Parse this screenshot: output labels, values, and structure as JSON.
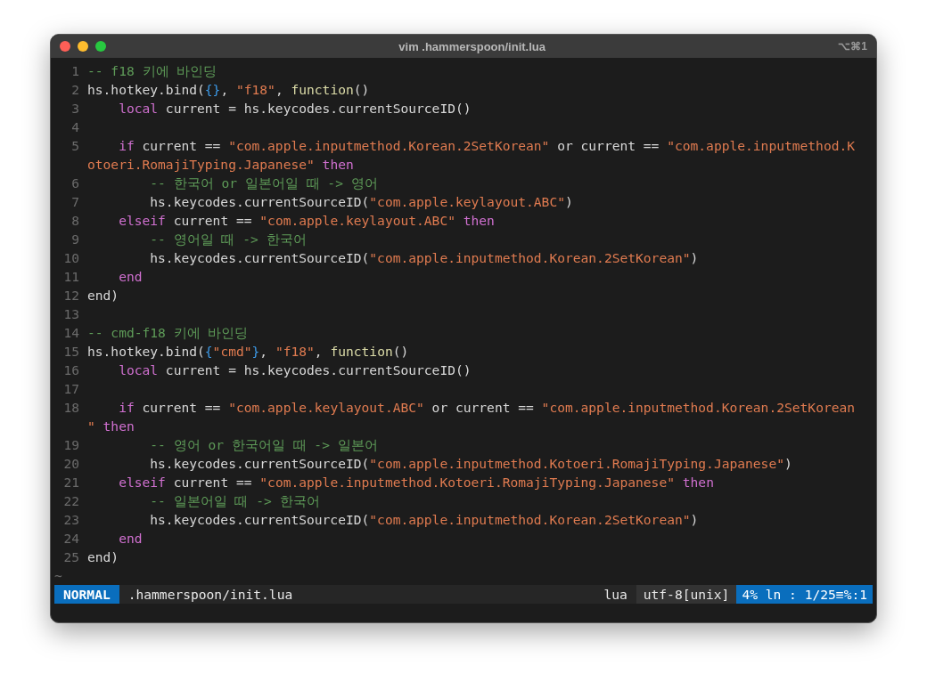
{
  "window": {
    "title": "vim .hammerspoon/init.lua",
    "shortcut": "⌥⌘1"
  },
  "editor": {
    "lines": [
      {
        "number": "1",
        "rows": [
          {
            "segments": [
              {
                "kind": "comment",
                "text": "-- f18 키에 바인딩"
              }
            ]
          }
        ]
      },
      {
        "number": "2",
        "rows": [
          {
            "segments": [
              {
                "kind": "plain",
                "text": "hs.hotkey.bind("
              },
              {
                "kind": "brace",
                "text": "{}"
              },
              {
                "kind": "plain",
                "text": ", "
              },
              {
                "kind": "string",
                "text": "\"f18\""
              },
              {
                "kind": "plain",
                "text": ", "
              },
              {
                "kind": "function",
                "text": "function"
              },
              {
                "kind": "plain",
                "text": "()"
              }
            ]
          }
        ]
      },
      {
        "number": "3",
        "rows": [
          {
            "segments": [
              {
                "kind": "keyword",
                "text": "    local"
              },
              {
                "kind": "plain",
                "text": " current = hs.keycodes.currentSourceID()"
              }
            ]
          }
        ]
      },
      {
        "number": "4"
      },
      {
        "number": "5",
        "rows": [
          {
            "segments": [
              {
                "kind": "keyword",
                "text": "    if"
              },
              {
                "kind": "plain",
                "text": " current == "
              },
              {
                "kind": "string",
                "text": "\"com.apple.inputmethod.Korean.2SetKorean\""
              },
              {
                "kind": "plain",
                "text": " or current == "
              },
              {
                "kind": "string",
                "text": "\"com.apple.inputmethod.K"
              }
            ]
          },
          {
            "segments": [
              {
                "kind": "string",
                "text": "otoeri.RomajiTyping.Japanese\""
              },
              {
                "kind": "keyword",
                "text": " then"
              }
            ]
          }
        ]
      },
      {
        "number": "6",
        "rows": [
          {
            "segments": [
              {
                "kind": "comment",
                "text": "        -- 한국어 or 일본어일 때 -> 영어"
              }
            ]
          }
        ]
      },
      {
        "number": "7",
        "rows": [
          {
            "segments": [
              {
                "kind": "plain",
                "text": "        hs.keycodes.currentSourceID("
              },
              {
                "kind": "string",
                "text": "\"com.apple.keylayout.ABC\""
              },
              {
                "kind": "plain",
                "text": ")"
              }
            ]
          }
        ]
      },
      {
        "number": "8",
        "rows": [
          {
            "segments": [
              {
                "kind": "keyword",
                "text": "    elseif"
              },
              {
                "kind": "plain",
                "text": " current == "
              },
              {
                "kind": "string",
                "text": "\"com.apple.keylayout.ABC\""
              },
              {
                "kind": "keyword",
                "text": " then"
              }
            ]
          }
        ]
      },
      {
        "number": "9",
        "rows": [
          {
            "segments": [
              {
                "kind": "comment",
                "text": "        -- 영어일 때 -> 한국어"
              }
            ]
          }
        ]
      },
      {
        "number": "10",
        "rows": [
          {
            "segments": [
              {
                "kind": "plain",
                "text": "        hs.keycodes.currentSourceID("
              },
              {
                "kind": "string",
                "text": "\"com.apple.inputmethod.Korean.2SetKorean\""
              },
              {
                "kind": "plain",
                "text": ")"
              }
            ]
          }
        ]
      },
      {
        "number": "11",
        "rows": [
          {
            "segments": [
              {
                "kind": "keyword",
                "text": "    end"
              }
            ]
          }
        ]
      },
      {
        "number": "12",
        "rows": [
          {
            "segments": [
              {
                "kind": "plain",
                "text": "end)"
              }
            ]
          }
        ]
      },
      {
        "number": "13"
      },
      {
        "number": "14",
        "rows": [
          {
            "segments": [
              {
                "kind": "comment",
                "text": "-- cmd-f18 키에 바인딩"
              }
            ]
          }
        ]
      },
      {
        "number": "15",
        "rows": [
          {
            "segments": [
              {
                "kind": "plain",
                "text": "hs.hotkey.bind("
              },
              {
                "kind": "brace",
                "text": "{"
              },
              {
                "kind": "string",
                "text": "\"cmd\""
              },
              {
                "kind": "brace",
                "text": "}"
              },
              {
                "kind": "plain",
                "text": ", "
              },
              {
                "kind": "string",
                "text": "\"f18\""
              },
              {
                "kind": "plain",
                "text": ", "
              },
              {
                "kind": "function",
                "text": "function"
              },
              {
                "kind": "plain",
                "text": "()"
              }
            ]
          }
        ]
      },
      {
        "number": "16",
        "rows": [
          {
            "segments": [
              {
                "kind": "keyword",
                "text": "    local"
              },
              {
                "kind": "plain",
                "text": " current = hs.keycodes.currentSourceID()"
              }
            ]
          }
        ]
      },
      {
        "number": "17"
      },
      {
        "number": "18",
        "rows": [
          {
            "segments": [
              {
                "kind": "keyword",
                "text": "    if"
              },
              {
                "kind": "plain",
                "text": " current == "
              },
              {
                "kind": "string",
                "text": "\"com.apple.keylayout.ABC\""
              },
              {
                "kind": "plain",
                "text": " or current == "
              },
              {
                "kind": "string",
                "text": "\"com.apple.inputmethod.Korean.2SetKorean"
              }
            ]
          },
          {
            "segments": [
              {
                "kind": "string",
                "text": "\""
              },
              {
                "kind": "keyword",
                "text": " then"
              }
            ]
          }
        ]
      },
      {
        "number": "19",
        "rows": [
          {
            "segments": [
              {
                "kind": "comment",
                "text": "        -- 영어 or 한국어일 때 -> 일본어"
              }
            ]
          }
        ]
      },
      {
        "number": "20",
        "rows": [
          {
            "segments": [
              {
                "kind": "plain",
                "text": "        hs.keycodes.currentSourceID("
              },
              {
                "kind": "string",
                "text": "\"com.apple.inputmethod.Kotoeri.RomajiTyping.Japanese\""
              },
              {
                "kind": "plain",
                "text": ")"
              }
            ]
          }
        ]
      },
      {
        "number": "21",
        "rows": [
          {
            "segments": [
              {
                "kind": "keyword",
                "text": "    elseif"
              },
              {
                "kind": "plain",
                "text": " current == "
              },
              {
                "kind": "string",
                "text": "\"com.apple.inputmethod.Kotoeri.RomajiTyping.Japanese\""
              },
              {
                "kind": "keyword",
                "text": " then"
              }
            ]
          }
        ]
      },
      {
        "number": "22",
        "rows": [
          {
            "segments": [
              {
                "kind": "comment",
                "text": "        -- 일본어일 때 -> 한국어"
              }
            ]
          }
        ]
      },
      {
        "number": "23",
        "rows": [
          {
            "segments": [
              {
                "kind": "plain",
                "text": "        hs.keycodes.currentSourceID("
              },
              {
                "kind": "string",
                "text": "\"com.apple.inputmethod.Korean.2SetKorean\""
              },
              {
                "kind": "plain",
                "text": ")"
              }
            ]
          }
        ]
      },
      {
        "number": "24",
        "rows": [
          {
            "segments": [
              {
                "kind": "keyword",
                "text": "    end"
              }
            ]
          }
        ]
      },
      {
        "number": "25",
        "rows": [
          {
            "segments": [
              {
                "kind": "plain",
                "text": "end)"
              }
            ]
          }
        ]
      }
    ],
    "tildes": [
      "~"
    ]
  },
  "status_bar": {
    "mode": "NORMAL",
    "file": ".hammerspoon/init.lua",
    "filetype": "lua",
    "encoding": "utf-8[unix]",
    "position": "4% ln : 1/25≡%:1"
  }
}
